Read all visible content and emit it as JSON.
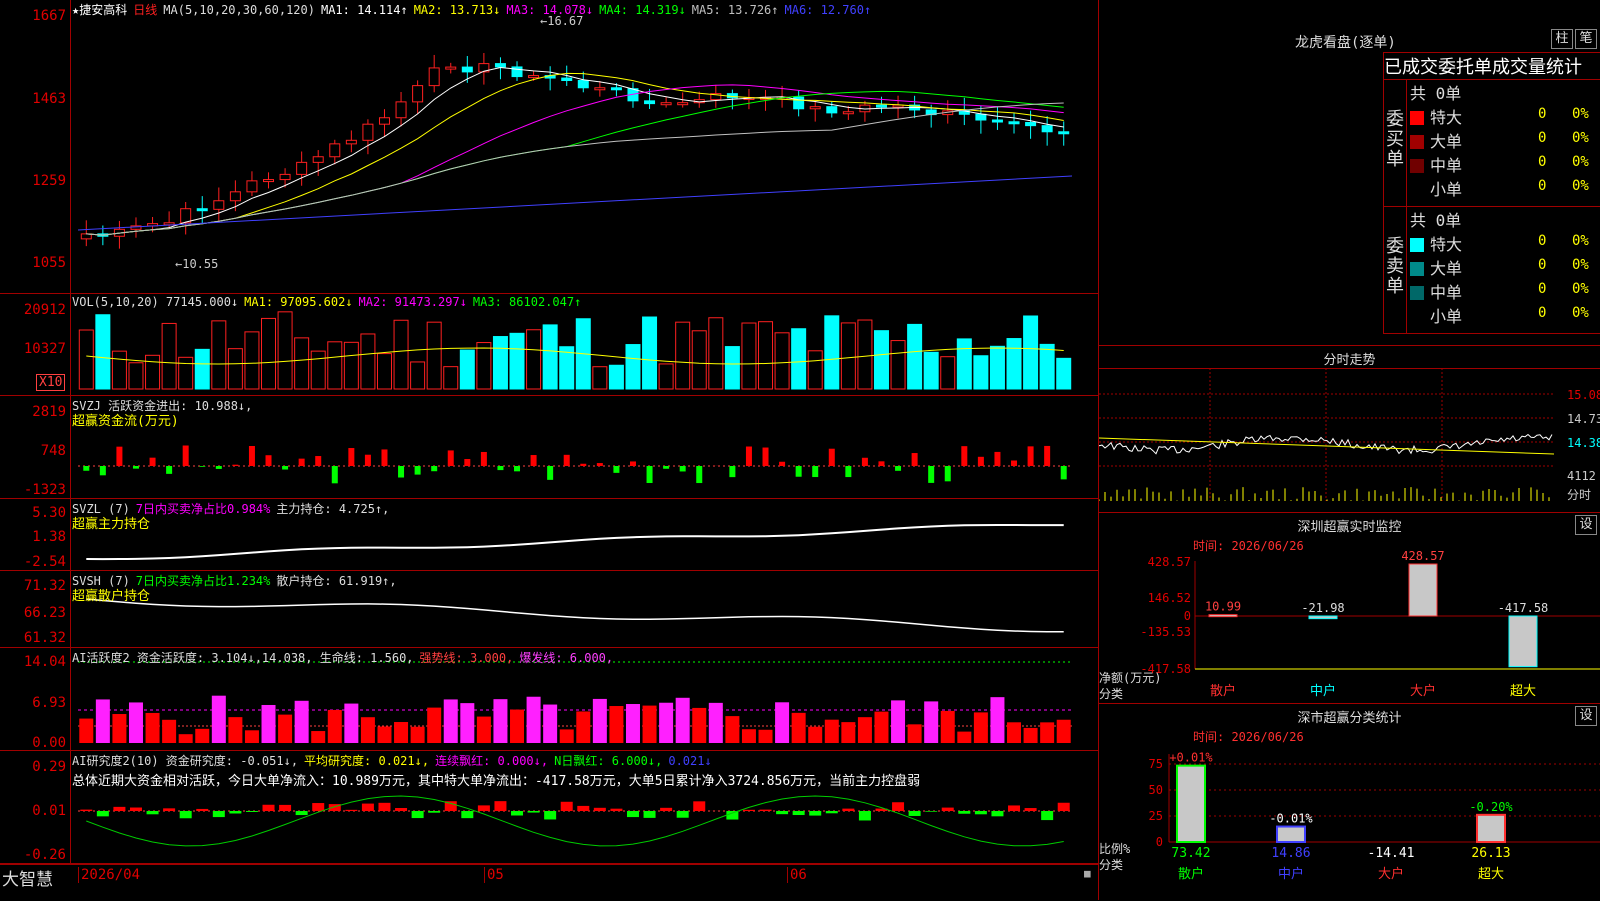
{
  "stock": {
    "star": "★",
    "name": "捷安高科",
    "period": "日线"
  },
  "ma_header": {
    "label": "MA(5,10,20,30,60,120)",
    "items": [
      {
        "text": "MA1: 14.114↑",
        "color": "#ffffff"
      },
      {
        "text": "MA2: 13.713↓",
        "color": "#ffff00"
      },
      {
        "text": "MA3: 14.078↓",
        "color": "#ff00ff"
      },
      {
        "text": "MA4: 14.319↓",
        "color": "#00ff00"
      },
      {
        "text": "MA5: 13.726↑",
        "color": "#c0c0c0"
      },
      {
        "text": "MA6: 12.760↑",
        "color": "#4040ff"
      }
    ]
  },
  "price_axis": [
    "1667",
    "1463",
    "1259",
    "1055"
  ],
  "price_annotations": {
    "high": "←16.67",
    "low": "←10.55"
  },
  "vol": {
    "header": "VOL(5,10,20) 77145.000↓",
    "ma": [
      "MA1: 97095.602↓",
      "MA2: 91473.297↓",
      "MA3: 86102.047↑"
    ],
    "axis": [
      "20912",
      "10327"
    ],
    "unit": "X10"
  },
  "svzj": {
    "header": "SVZJ  活跃资金进出: 10.988↓,",
    "sub": "超赢资金流(万元)",
    "axis": [
      "2819",
      "748",
      "-1323"
    ]
  },
  "svzl": {
    "header_a": "SVZL (7)",
    "header_b": "7日内买卖净占比0.984%",
    "header_c": "主力持仓: 4.725↑,",
    "sub": "超赢主力持仓",
    "axis": [
      "5.30",
      "1.38",
      "-2.54"
    ]
  },
  "svsh": {
    "header_a": "SVSH (7)",
    "header_b": "7日内买卖净占比1.234%",
    "header_c": "散户持仓: 61.919↑,",
    "sub": "超赢散户持仓",
    "axis": [
      "71.32",
      "66.23",
      "61.32"
    ]
  },
  "ai_active": {
    "header": "AI活跃度2 资金活跃度: 3.104↓,14.038, 生命线: 1.560,",
    "strong": "强势线: 3.000,",
    "burst": "爆发线: 6.000,",
    "axis": [
      "14.04",
      "6.93",
      "0.00"
    ]
  },
  "ai_research": {
    "header": "AI研究度2(10) 资金研究度: -0.051↓,",
    "avg": "平均研究度: 0.021↓,",
    "cont": "连续飘红: 0.000↓,",
    "nday": "N日飘红: 6.000↓,",
    "tail": "0.021↓",
    "summary": "总体近期大资金相对活跃，今日大单净流入：10.989万元，其中特大单净流出：-417.58万元，大单5日累计净入3724.856万元，当前主力控盘弱",
    "axis": [
      "0.29",
      "0.01",
      "-0.26"
    ]
  },
  "time_axis": {
    "brand": "大智慧",
    "labels": [
      "2026/04",
      "05",
      "06"
    ]
  },
  "dragon": {
    "title": "龙虎看盘(逐单)",
    "buttons": [
      "柱",
      "笔"
    ],
    "tabs": [
      "已成交",
      "委托单",
      "成交量统计"
    ],
    "buy_label": "委买单",
    "sell_label": "委卖单",
    "buy_total": "共 0单",
    "sell_total": "共 0单",
    "buy_rows": [
      {
        "name": "特大",
        "n": "0",
        "p": "0%",
        "color": "#ff0000"
      },
      {
        "name": "大单",
        "n": "0",
        "p": "0%",
        "color": "#a00000"
      },
      {
        "name": "中单",
        "n": "0",
        "p": "0%",
        "color": "#700000"
      },
      {
        "name": "小单",
        "n": "0",
        "p": "0%",
        "color": "#000000"
      }
    ],
    "sell_rows": [
      {
        "name": "特大",
        "n": "0",
        "p": "0%",
        "color": "#00ffff"
      },
      {
        "name": "大单",
        "n": "0",
        "p": "0%",
        "color": "#008a8a"
      },
      {
        "name": "中单",
        "n": "0",
        "p": "0%",
        "color": "#006868"
      },
      {
        "name": "小单",
        "n": "0",
        "p": "0%",
        "color": "#000000"
      }
    ]
  },
  "intraday": {
    "title": "分时走势",
    "axis": [
      "15.08",
      "14.73",
      "14.38",
      "4112",
      "分时"
    ]
  },
  "monitor": {
    "title": "深圳超赢实时监控",
    "button": "设",
    "time": "时间: 2026/06/26",
    "axis": [
      "428.57",
      "146.52",
      "0",
      "-135.53",
      "-417.58"
    ],
    "ylabel": "净额(万元)",
    "xlabel": "分类",
    "bars": [
      {
        "cat": "散户",
        "value": 10.99,
        "label": "10.99"
      },
      {
        "cat": "中户",
        "value": -21.98,
        "label": "-21.98"
      },
      {
        "cat": "大户",
        "value": 428.57,
        "label": "428.57"
      },
      {
        "cat": "超大",
        "value": -417.58,
        "label": "-417.58"
      }
    ]
  },
  "classify": {
    "title": "深市超赢分类统计",
    "button": "设",
    "time": "时间: 2026/06/26",
    "axis": [
      "75",
      "50",
      "25",
      "0"
    ],
    "ylabel": "比例%",
    "xlabel": "分类",
    "bars": [
      {
        "cat": "散户",
        "value": 73.42,
        "top": "+0.01%",
        "bottom": "73.42"
      },
      {
        "cat": "中户",
        "value": 14.86,
        "top": "-0.01%",
        "bottom": "14.86"
      },
      {
        "cat": "大户",
        "value": 0,
        "top": "",
        "bottom": "-14.41"
      },
      {
        "cat": "超大",
        "value": 26.13,
        "top": "-0.20%",
        "bottom": "26.13"
      }
    ]
  },
  "colors": {
    "up": "#ff0000",
    "down": "#00ffff",
    "border": "#a00000",
    "text_axis": "#e00000"
  }
}
